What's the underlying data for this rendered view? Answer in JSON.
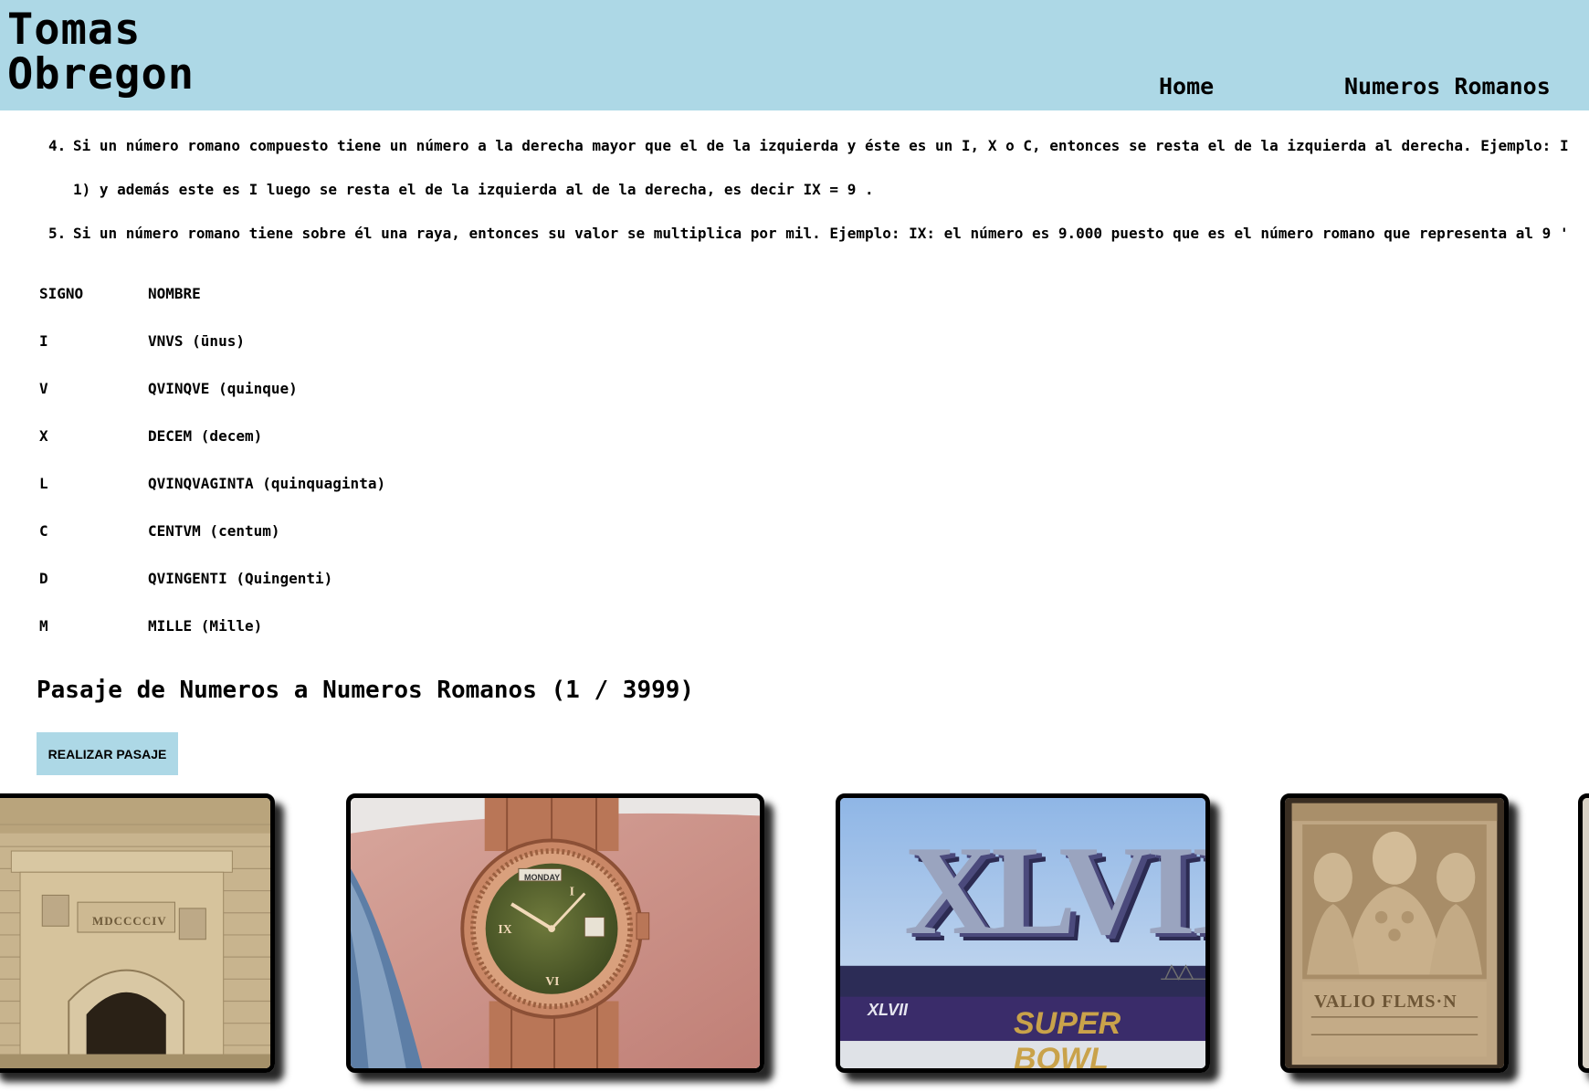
{
  "header": {
    "brand_line1": "Tomas",
    "brand_line2": "Obregon",
    "nav": [
      "Home",
      "Numeros Romanos"
    ],
    "background": "#add8e6"
  },
  "rules": {
    "rule4_num": "4.",
    "rule4_text": "Si un número romano compuesto tiene un número a la derecha mayor que el de la izquierda y éste es un I, X o C, entonces se resta el de la izquierda al derecha. Ejemplo: I",
    "rule4b_text": "1) y además este es I luego se resta el de la izquierda al de la derecha, es decir IX = 9 .",
    "rule5_num": "5.",
    "rule5_text": "Si un número romano tiene sobre él una raya, entonces su valor se multiplica por mil. Ejemplo: IX: el número es 9.000 puesto que es el número romano que representa al 9 '"
  },
  "table": {
    "headers": [
      "SIGNO",
      "NOMBRE"
    ],
    "rows": [
      {
        "signo": "I",
        "nombre": "VNVS (ūnus)"
      },
      {
        "signo": "V",
        "nombre": "QVINQVE (quinque)"
      },
      {
        "signo": "X",
        "nombre": "DECEM (decem)"
      },
      {
        "signo": "L",
        "nombre": "QVINQVAGINTA (quinquaginta)"
      },
      {
        "signo": "C",
        "nombre": "CENTVM (centum)"
      },
      {
        "signo": "D",
        "nombre": "QVINGENTI (Quingenti)"
      },
      {
        "signo": "M",
        "nombre": "MILLE (Mille)"
      }
    ]
  },
  "section": {
    "title": "Pasaje de Numeros a Numeros Romanos (1 / 3999)",
    "button_label": "REALIZAR PASAJE"
  },
  "photos": {
    "arch_inscription": "MDCCCCIV",
    "watch_day": "MONDAY",
    "superbowl_numeral": "XLVII",
    "superbowl_text": "SUPER BOWL",
    "superbowl_small": "XLVII",
    "relief_inscription": "VALIO FLMS·N"
  }
}
